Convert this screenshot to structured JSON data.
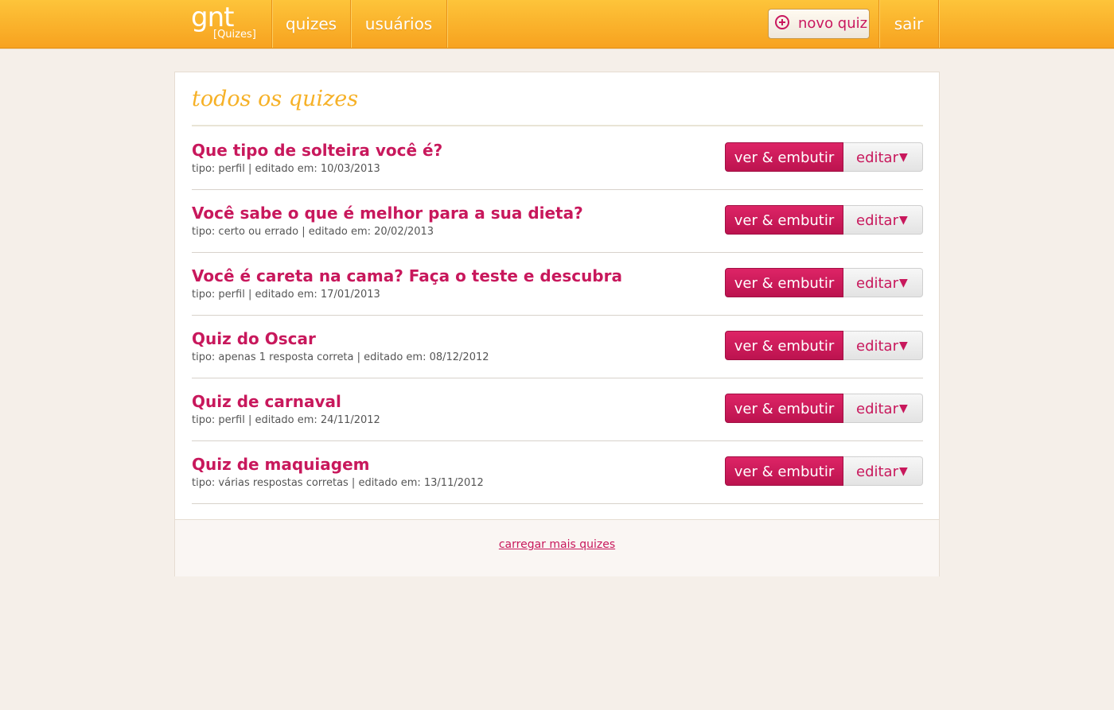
{
  "header": {
    "logo_main": "gnt",
    "logo_sub": "[Quizes]",
    "nav": [
      {
        "label": "quizes"
      },
      {
        "label": "usuários"
      }
    ],
    "new_quiz_label": "novo quiz",
    "logout_label": "sair"
  },
  "main": {
    "title": "todos os quizes",
    "quizzes": [
      {
        "title": "Que tipo de solteira você é?",
        "meta": "tipo: perfil | editado em: 10/03/2013"
      },
      {
        "title": "Você sabe o que é melhor para a sua dieta?",
        "meta": "tipo: certo ou errado | editado em: 20/02/2013"
      },
      {
        "title": "Você é careta na cama? Faça o teste e descubra",
        "meta": "tipo: perfil | editado em: 17/01/2013"
      },
      {
        "title": "Quiz do Oscar",
        "meta": "tipo: apenas 1 resposta correta | editado em: 08/12/2012"
      },
      {
        "title": "Quiz de carnaval",
        "meta": "tipo: perfil | editado em: 24/11/2012"
      },
      {
        "title": "Quiz de maquiagem",
        "meta": "tipo: várias respostas corretas | editado em: 13/11/2012"
      }
    ],
    "view_embed_label": "ver & embutir",
    "edit_label": "editar",
    "edit_caret": "▼",
    "load_more_label": "carregar mais quizes"
  },
  "colors": {
    "header_orange": "#f7a21f",
    "accent_pink": "#c8185c",
    "title_yellow": "#f6b127",
    "background": "#f5efe9"
  },
  "icons": {
    "new_quiz": "plus-circle-icon",
    "edit_dropdown": "caret-down-icon"
  }
}
